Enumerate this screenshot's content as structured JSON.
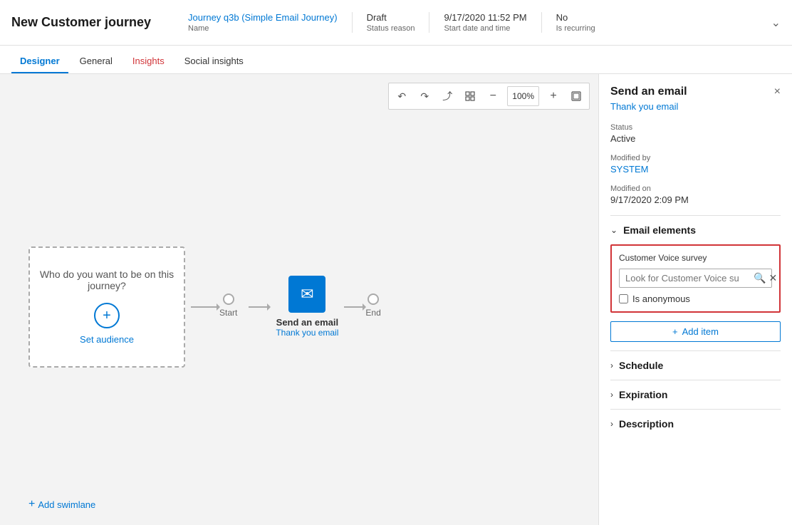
{
  "header": {
    "title": "New Customer journey",
    "journey_name": "Journey q3b (Simple Email Journey)",
    "journey_name_label": "Name",
    "status": "Draft",
    "status_label": "Status reason",
    "start_date": "9/17/2020 11:52 PM",
    "start_date_label": "Start date and time",
    "recurring": "No",
    "recurring_label": "Is recurring"
  },
  "tabs": [
    {
      "id": "designer",
      "label": "Designer",
      "active": true,
      "style": "active"
    },
    {
      "id": "general",
      "label": "General",
      "active": false,
      "style": "normal"
    },
    {
      "id": "insights",
      "label": "Insights",
      "active": false,
      "style": "red"
    },
    {
      "id": "social-insights",
      "label": "Social insights",
      "active": false,
      "style": "normal"
    }
  ],
  "toolbar": {
    "undo": "↺",
    "redo": "↻",
    "expand": "⤢",
    "grid": "⊞",
    "zoom_out": "−",
    "zoom_level": "100%",
    "zoom_in": "+",
    "fit": "⊡"
  },
  "canvas": {
    "audience_text": "Who do you want to be on this journey?",
    "set_audience_label": "Set audience",
    "start_label": "Start",
    "end_label": "End",
    "email_node_label": "Send an email",
    "email_node_sublabel": "Thank you email",
    "add_swimlane_label": "Add swimlane"
  },
  "panel": {
    "title": "Send an email",
    "subtitle": "Thank you email",
    "close_icon": "×",
    "status_label": "Status",
    "status_value": "Active",
    "modified_by_label": "Modified by",
    "modified_by_value": "SYSTEM",
    "modified_on_label": "Modified on",
    "modified_on_value": "9/17/2020 2:09 PM",
    "email_elements_title": "Email elements",
    "cv_survey_label": "Customer Voice survey",
    "cv_search_placeholder": "Look for Customer Voice su",
    "cv_anonymous_label": "Is anonymous",
    "add_item_label": "Add item",
    "schedule_title": "Schedule",
    "expiration_title": "Expiration",
    "description_title": "Description"
  }
}
